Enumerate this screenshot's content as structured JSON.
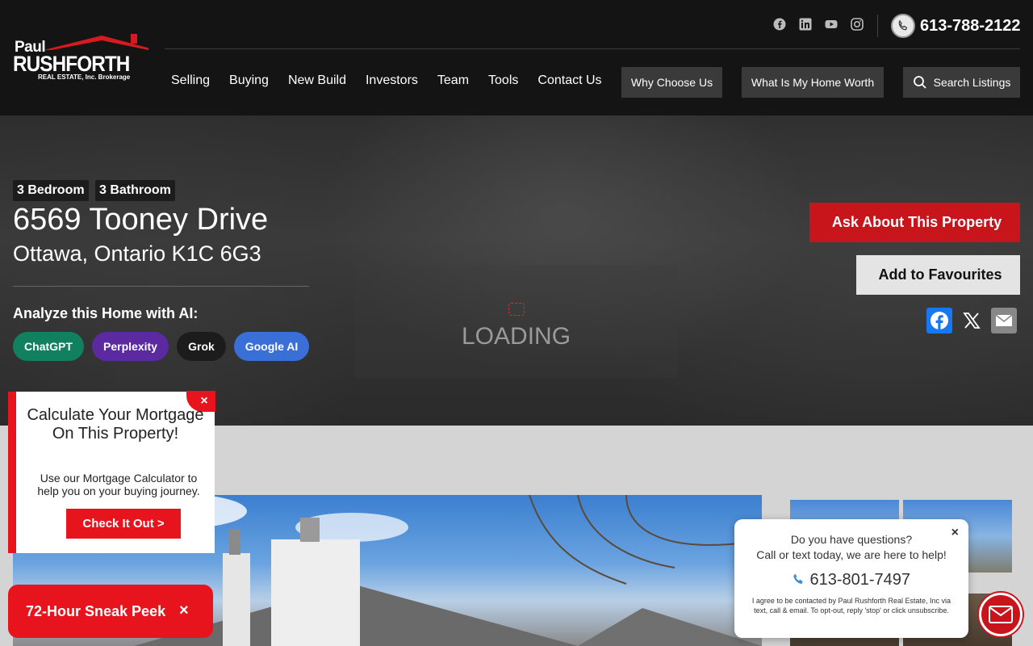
{
  "brand": {
    "line1": "Paul",
    "line2": "RUSHFORTH",
    "line3": "REAL ESTATE, Inc. Brokerage"
  },
  "header": {
    "phone": "613-788-2122",
    "social": [
      "facebook-icon",
      "linkedin-icon",
      "youtube-icon",
      "instagram-icon"
    ]
  },
  "nav": {
    "items": [
      "Selling",
      "Buying",
      "New Build",
      "Investors",
      "Team",
      "Tools",
      "Contact Us"
    ],
    "why": "Why Choose Us",
    "worth": "What Is My Home Worth",
    "search": "Search Listings"
  },
  "listing": {
    "bedrooms": "3 Bedroom",
    "bathrooms": "3 Bathroom",
    "address": "6569 Tooney Drive",
    "city": "Ottawa, Ontario K1C 6G3",
    "ai_label": "Analyze this Home with AI:",
    "ai_buttons": [
      {
        "label": "ChatGPT",
        "color": "#10805f"
      },
      {
        "label": "Perplexity",
        "color": "#5b2aa0"
      },
      {
        "label": "Grok",
        "color": "#1c1c1c"
      },
      {
        "label": "Google AI",
        "color": "#3a6fd8"
      }
    ],
    "loading": "LOADING",
    "ask": "Ask About This Property",
    "favourite": "Add to Favourites",
    "icon_glyph": ""
  },
  "mortgage_popup": {
    "title": "Calculate Your Mortgage On This Property!",
    "description": "Use our Mortgage Calculator to help you on your buying journey.",
    "cta": "Check It Out >",
    "close": "×"
  },
  "sneak_peek": {
    "label": "72-Hour Sneak Peek",
    "close": "×"
  },
  "chat": {
    "question": "Do you have questions?",
    "subtitle": "Call or text today, we are here to help!",
    "phone": "613-801-7497",
    "legal": "I agree to be contacted by Paul Rushforth Real Estate, Inc via text, call & email. To opt-out, reply 'stop' or click unsubscribe.",
    "close": "×"
  },
  "colors": {
    "accent": "#e8141d",
    "header_bg": "#141414"
  }
}
